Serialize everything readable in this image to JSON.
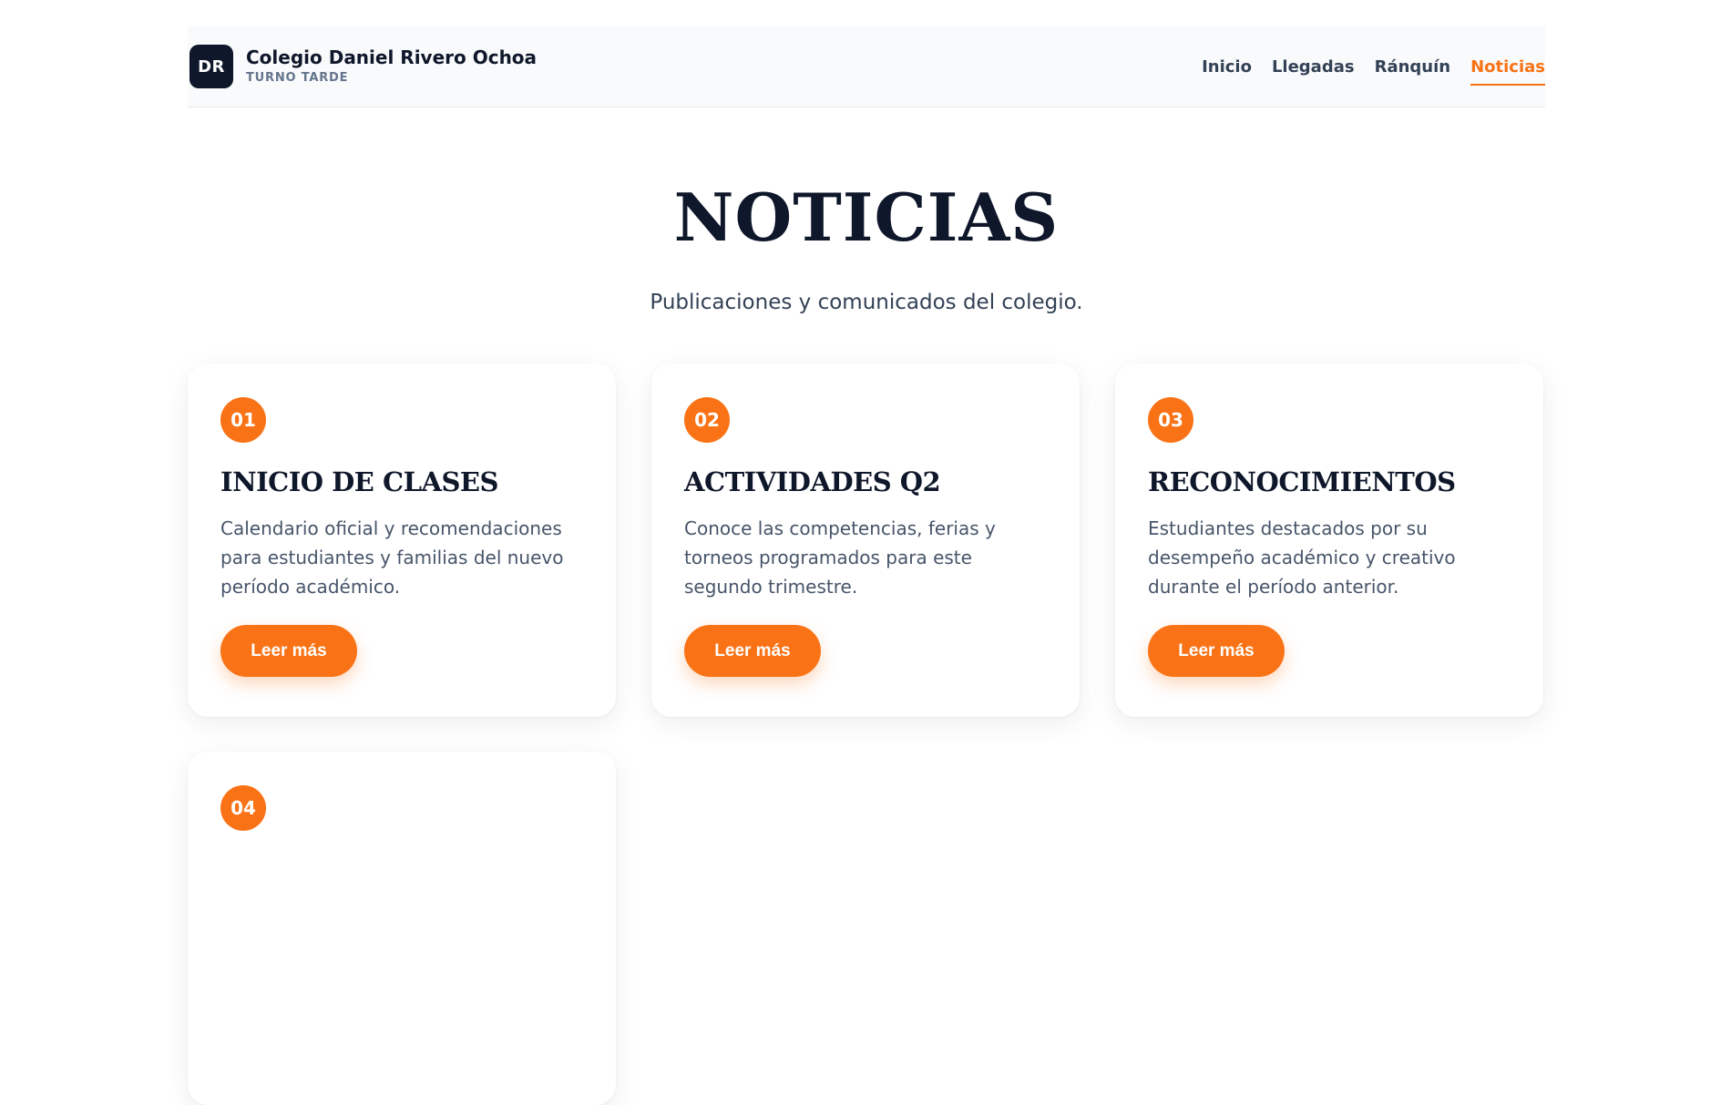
{
  "header": {
    "logo_initials": "DR",
    "brand_name": "Colegio Daniel Rivero Ochoa",
    "brand_sub": "TURNO TARDE",
    "nav": [
      "Inicio",
      "Llegadas",
      "Ránquín",
      "Noticias"
    ],
    "active_nav": "Noticias"
  },
  "hero": {
    "title": "NOTICIAS",
    "subtitle": "Publicaciones y comunicados del colegio."
  },
  "cards": [
    {
      "number": "01",
      "title": "INICIO DE CLASES",
      "text": "Calendario oficial y recomendaciones para estudiantes y familias del nuevo período académico.",
      "button": "Leer más"
    },
    {
      "number": "02",
      "title": "ACTIVIDADES Q2",
      "text": "Conoce las competencias, ferias y torneos programados para este segundo trimestre.",
      "button": "Leer más"
    },
    {
      "number": "03",
      "title": "RECONOCIMIENTOS",
      "text": "Estudiantes destacados por su desempeño académico y creativo durante el período anterior.",
      "button": "Leer más"
    },
    {
      "number": "04"
    }
  ],
  "colors": {
    "accent": "#f97316",
    "dark": "#0f172a",
    "header_bg": "#f8fafc"
  }
}
